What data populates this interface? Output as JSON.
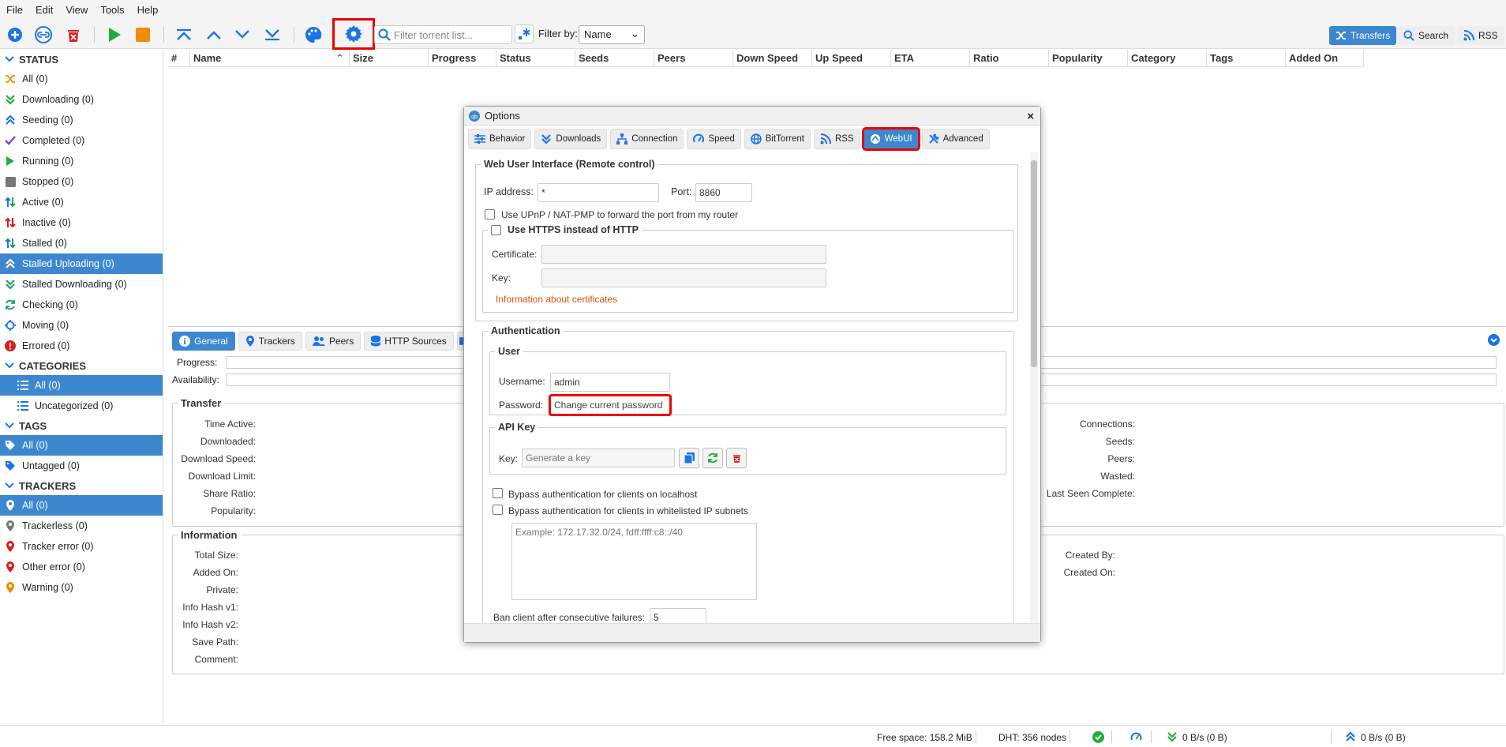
{
  "menu": [
    "File",
    "Edit",
    "View",
    "Tools",
    "Help"
  ],
  "toolbar": {
    "filter_placeholder": "Filter torrent list...",
    "filter_by_label": "Filter by:",
    "filter_by_value": "Name",
    "transfers_label": "Transfers",
    "search_label": "Search",
    "rss_label": "RSS"
  },
  "sidebar": {
    "status_header": "STATUS",
    "status_items": [
      "All (0)",
      "Downloading (0)",
      "Seeding (0)",
      "Completed (0)",
      "Running (0)",
      "Stopped (0)",
      "Active (0)",
      "Inactive (0)",
      "Stalled (0)",
      "Stalled Uploading (0)",
      "Stalled Downloading (0)",
      "Checking (0)",
      "Moving (0)",
      "Errored (0)"
    ],
    "categories_header": "CATEGORIES",
    "category_items": [
      "All (0)",
      "Uncategorized (0)"
    ],
    "tags_header": "TAGS",
    "tag_items": [
      "All (0)",
      "Untagged (0)"
    ],
    "trackers_header": "TRACKERS",
    "tracker_items": [
      "All (0)",
      "Trackerless (0)",
      "Tracker error (0)",
      "Other error (0)",
      "Warning (0)"
    ]
  },
  "columns": [
    "#",
    "Name",
    "Size",
    "Progress",
    "Status",
    "Seeds",
    "Peers",
    "Down Speed",
    "Up Speed",
    "ETA",
    "Ratio",
    "Popularity",
    "Category",
    "Tags",
    "Added On"
  ],
  "details": {
    "tabs": [
      "General",
      "Trackers",
      "Peers",
      "HTTP Sources"
    ],
    "progress_label": "Progress:",
    "availability_label": "Availability:",
    "transfer_title": "Transfer",
    "transfer_left": [
      "Time Active:",
      "Downloaded:",
      "Download Speed:",
      "Download Limit:",
      "Share Ratio:",
      "Popularity:"
    ],
    "transfer_right": [
      "Connections:",
      "Seeds:",
      "Peers:",
      "Wasted:",
      "Last Seen Complete:"
    ],
    "information_title": "Information",
    "info_left": [
      "Total Size:",
      "Added On:",
      "Private:",
      "Info Hash v1:",
      "Info Hash v2:",
      "Save Path:",
      "Comment:"
    ],
    "info_right": [
      "Created By:",
      "Created On:"
    ]
  },
  "status_bar": {
    "free_space": "Free space: 158.2 MiB",
    "dht": "DHT: 356 nodes",
    "down": "0 B/s (0 B)",
    "up": "0 B/s (0 B)"
  },
  "dialog": {
    "title": "Options",
    "tabs": [
      "Behavior",
      "Downloads",
      "Connection",
      "Speed",
      "BitTorrent",
      "RSS",
      "WebUI",
      "Advanced"
    ],
    "webui_title": "Web User Interface (Remote control)",
    "ip_label": "IP address:",
    "ip_value": "*",
    "port_label": "Port:",
    "port_value": "8860",
    "upnp_label": "Use UPnP / NAT-PMP to forward the port from my router",
    "https_label": "Use HTTPS instead of HTTP",
    "cert_label": "Certificate:",
    "key_label": "Key:",
    "cert_info_link": "Information about certificates",
    "auth_title": "Authentication",
    "user_title": "User",
    "username_label": "Username:",
    "username_value": "admin",
    "password_label": "Password:",
    "password_placeholder": "Change current password",
    "apikey_title": "API Key",
    "apikey_label": "Key:",
    "apikey_placeholder": "Generate a key",
    "bypass_localhost": "Bypass authentication for clients on localhost",
    "bypass_whitelist": "Bypass authentication for clients in whitelisted IP subnets",
    "whitelist_placeholder": "Example: 172.17.32.0/24, fdff:ffff:c8::/40",
    "ban_label": "Ban client after consecutive failures:",
    "ban_value": "5"
  }
}
